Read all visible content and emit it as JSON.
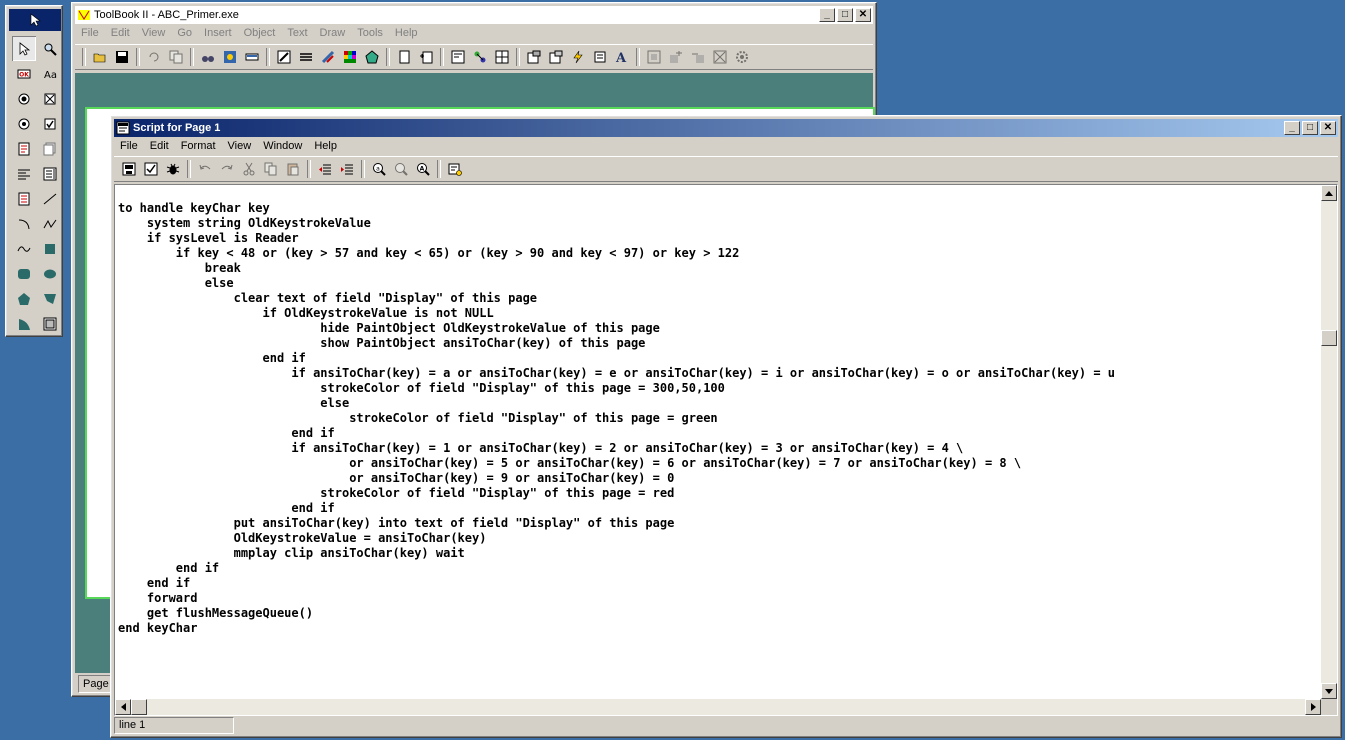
{
  "palette": {
    "tools": [
      "pointer-tool-icon",
      "zoom-tool-icon",
      "button-tool-icon",
      "label-tool-icon",
      "radio-button-tool-icon",
      "checkbox-cross-tool-icon",
      "radio-alt-tool-icon",
      "checkbox-tool-icon",
      "field-tool-icon",
      "record-field-tool-icon",
      "text-align-tool-icon",
      "combo-box-tool-icon",
      "list-tool-icon",
      "line-tool-icon",
      "arc-tool-icon",
      "polyline-tool-icon",
      "curve-tool-icon",
      "rectangle-tool-icon",
      "rounded-rect-tool-icon",
      "ellipse-tool-icon",
      "pentagon-tool-icon",
      "irregular-polygon-tool-icon",
      "pie-tool-icon",
      "stage-tool-icon"
    ]
  },
  "toolbook": {
    "title": "ToolBook II - ABC_Primer.exe",
    "menus": [
      "File",
      "Edit",
      "View",
      "Go",
      "Insert",
      "Object",
      "Text",
      "Draw",
      "Tools",
      "Help"
    ],
    "status": "Page"
  },
  "script": {
    "title": "Script for Page 1",
    "menus": [
      "File",
      "Edit",
      "Format",
      "View",
      "Window",
      "Help"
    ],
    "code": "to handle keyChar key\n    system string OldKeystrokeValue\n    if sysLevel is Reader\n        if key < 48 or (key > 57 and key < 65) or (key > 90 and key < 97) or key > 122\n            break\n            else\n                clear text of field \"Display\" of this page\n                    if OldKeystrokeValue is not NULL\n                            hide PaintObject OldKeystrokeValue of this page\n                            show PaintObject ansiToChar(key) of this page\n                    end if\n                        if ansiToChar(key) = a or ansiToChar(key) = e or ansiToChar(key) = i or ansiToChar(key) = o or ansiToChar(key) = u\n                            strokeColor of field \"Display\" of this page = 300,50,100\n                            else\n                                strokeColor of field \"Display\" of this page = green\n                        end if\n                        if ansiToChar(key) = 1 or ansiToChar(key) = 2 or ansiToChar(key) = 3 or ansiToChar(key) = 4 \\\n                                or ansiToChar(key) = 5 or ansiToChar(key) = 6 or ansiToChar(key) = 7 or ansiToChar(key) = 8 \\\n                                or ansiToChar(key) = 9 or ansiToChar(key) = 0\n                            strokeColor of field \"Display\" of this page = red\n                        end if\n                put ansiToChar(key) into text of field \"Display\" of this page\n                OldKeystrokeValue = ansiToChar(key)\n                mmplay clip ansiToChar(key) wait\n        end if\n    end if\n    forward\n    get flushMessageQueue()\nend keyChar",
    "status": "line 1"
  }
}
